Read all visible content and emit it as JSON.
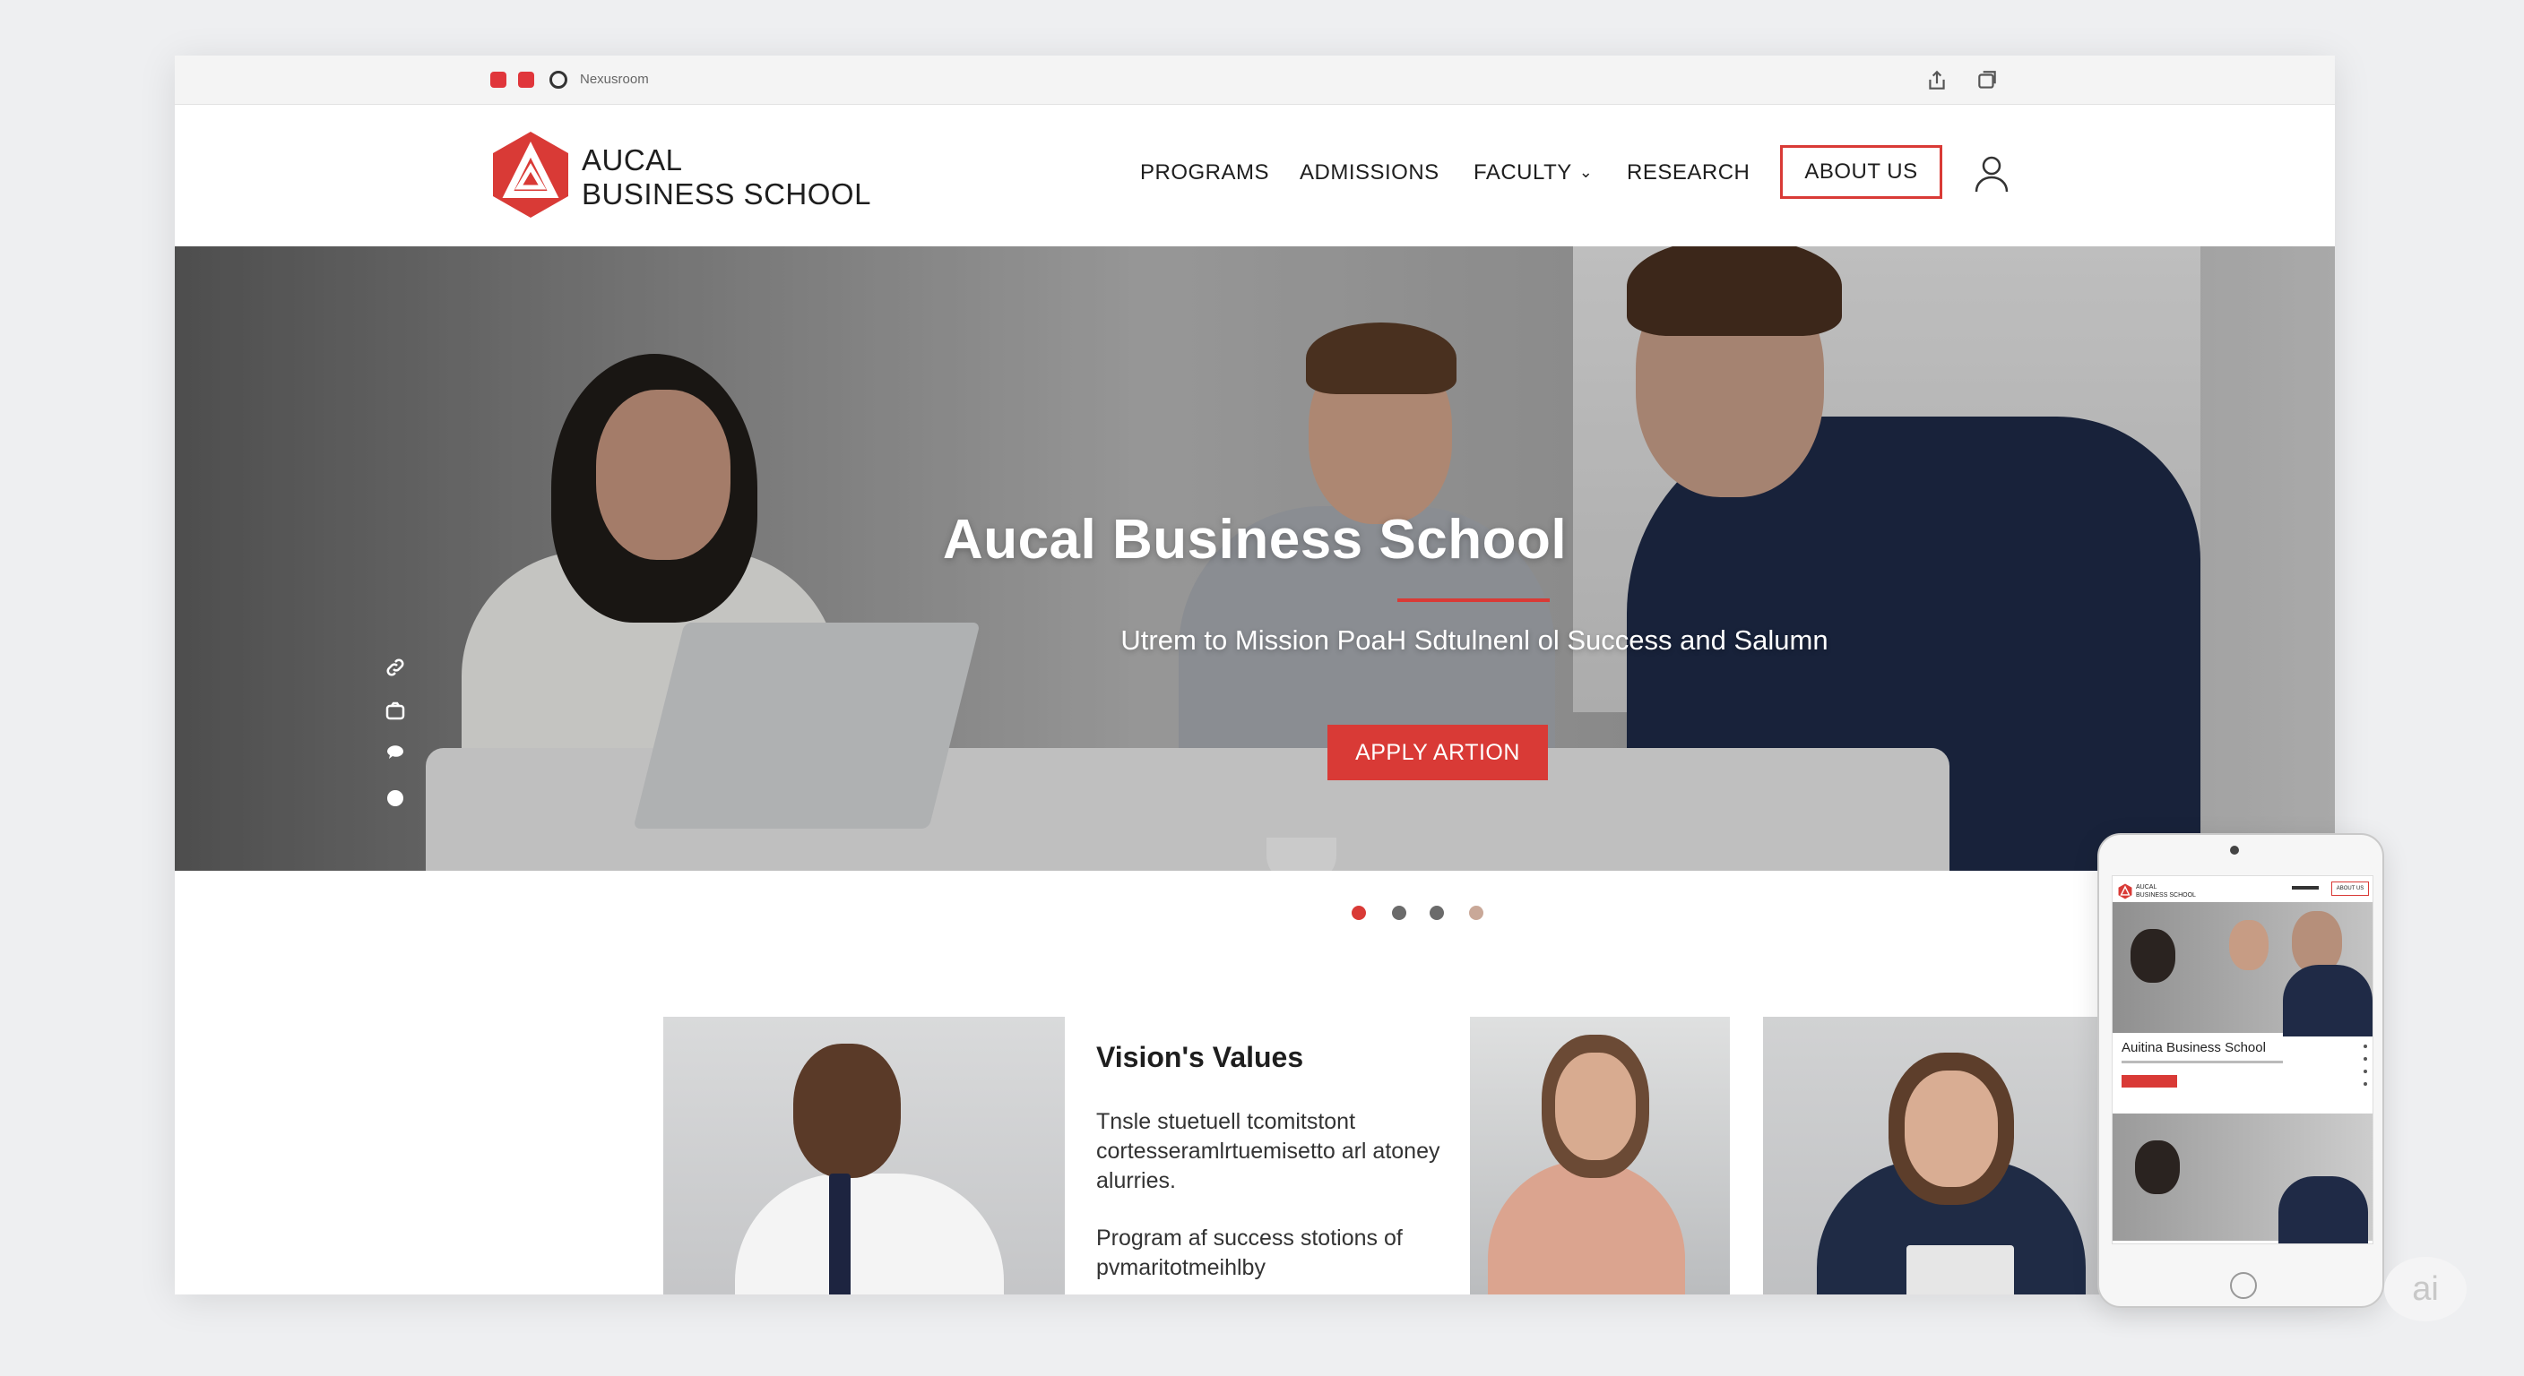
{
  "browser": {
    "url": "Nexusroom",
    "icons": [
      "share-icon",
      "tabs-icon"
    ]
  },
  "header": {
    "brand_line1": "AUCAL",
    "brand_line2": "BUSINESS SCHOOL",
    "nav": [
      "PROGRAMS",
      "ADMISSIONS",
      "FACULTY",
      "RESEARCH"
    ],
    "about_label": "ABOUT US",
    "accent": "#d93a36"
  },
  "hero": {
    "title": "Aucal Business School",
    "subtitle": "Utrem to Mission PoaH Sdtulnenl ol Success and Salumn",
    "apply_label": "APPLY ARTION",
    "carousel_active": 1,
    "carousel_count": 4
  },
  "values": {
    "title": "Vision's Values",
    "p1": "Tnsle stuetuell tcomitstont cortesseramlrtuemisetto arl atoney alurries.",
    "p2": "Program af success stotions of pvmaritotmeihlby"
  },
  "phone": {
    "brand_line1": "AUCAL",
    "brand_line2": "BUSINESS SCHOOL",
    "about_label": "ABOUT US",
    "title": "Auitina Business School"
  },
  "watermark": "ai"
}
